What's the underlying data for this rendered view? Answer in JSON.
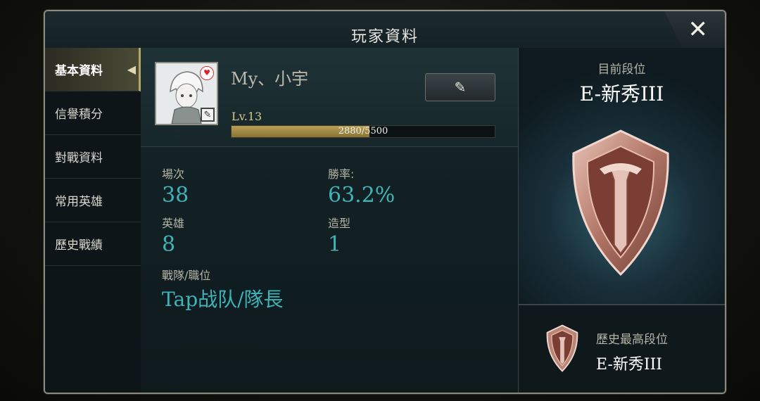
{
  "window": {
    "title": "玩家資料",
    "close_label": "✕"
  },
  "sidebar": {
    "items": [
      {
        "label": "基本資料",
        "active": true
      },
      {
        "label": "信譽積分",
        "active": false
      },
      {
        "label": "對戰資料",
        "active": false
      },
      {
        "label": "常用英雄",
        "active": false
      },
      {
        "label": "歷史戰績",
        "active": false
      }
    ]
  },
  "profile": {
    "name": "My、小宇",
    "level": "Lv.13",
    "xp_text": "2880/5500",
    "xp_fraction": 0.5236,
    "edit_icon": "pencil-icon"
  },
  "stats": {
    "matches_label": "場次",
    "matches_value": "38",
    "winrate_label": "勝率:",
    "winrate_value": "63.2%",
    "heroes_label": "英雄",
    "heroes_value": "8",
    "skins_label": "造型",
    "skins_value": "1",
    "team_label": "戰隊/職位",
    "team_value": "Tap战队/隊長"
  },
  "rank": {
    "current_label": "目前段位",
    "current_value": "E-新秀III",
    "highest_label": "歷史最高段位",
    "highest_value": "E-新秀III"
  },
  "colors": {
    "accent_teal": "#3eb3b8",
    "xp_gold": "#b79f55",
    "emblem_copper": "#c89a88"
  }
}
